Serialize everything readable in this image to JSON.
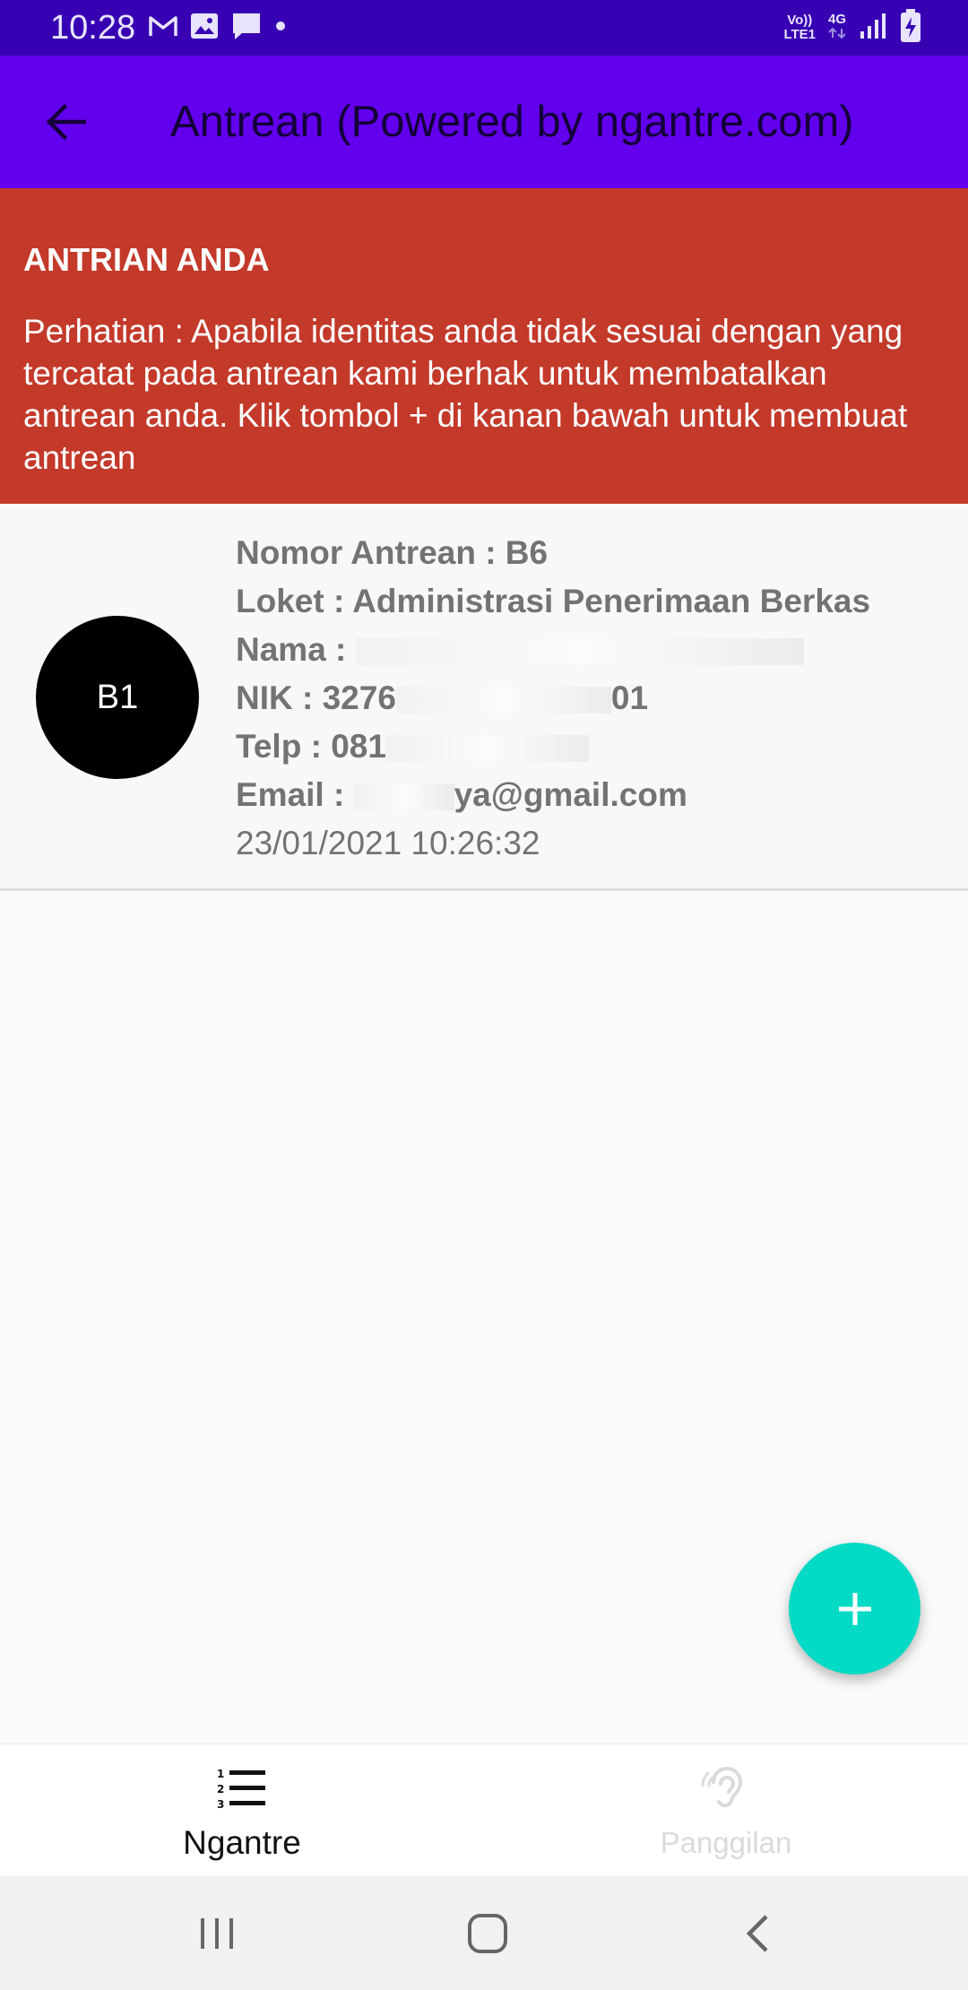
{
  "status_bar": {
    "time": "10:28",
    "left_icons": [
      "gmail-icon",
      "gallery-icon",
      "message-icon",
      "dot-icon"
    ],
    "network_top": "Vo))",
    "network_bottom": "LTE1",
    "data_type": "4G",
    "right_icons": [
      "volte-icon",
      "data-4g-icon",
      "signal-icon",
      "battery-charging-icon"
    ]
  },
  "app_bar": {
    "title": "Antrean (Powered by ngantre.com)",
    "back_icon": "arrow-left-icon",
    "color": "#6200ee"
  },
  "notice": {
    "heading": "ANTRIAN ANDA",
    "body": "Perhatian : Apabila identitas anda tidak sesuai dengan yang tercatat pada antrean kami berhak untuk membatalkan antrean anda. Klik tombol + di kanan bawah untuk membuat antrean",
    "color": "#c3392a"
  },
  "queue_item": {
    "avatar_text": "B1",
    "number": "Nomor Antrean : B6",
    "counter": "Loket : Administrasi Penerimaan Berkas",
    "name_label": "Nama : ",
    "nik_label": "NIK : 3276",
    "nik_tail": "01",
    "phone_label": "Telp : 081",
    "email_label": "Email : ",
    "email_tail": "ya@gmail.com",
    "timestamp": "23/01/2021 10:26:32"
  },
  "fab": {
    "icon": "plus-icon",
    "color": "#03dac5"
  },
  "bottom_nav": {
    "tabs": [
      {
        "label": "Ngantre",
        "icon": "numbered-list-icon",
        "active": true
      },
      {
        "label": "Panggilan",
        "icon": "hearing-icon",
        "active": false
      }
    ]
  },
  "system_nav": {
    "icons": [
      "recent-apps-icon",
      "home-icon",
      "back-icon"
    ]
  }
}
